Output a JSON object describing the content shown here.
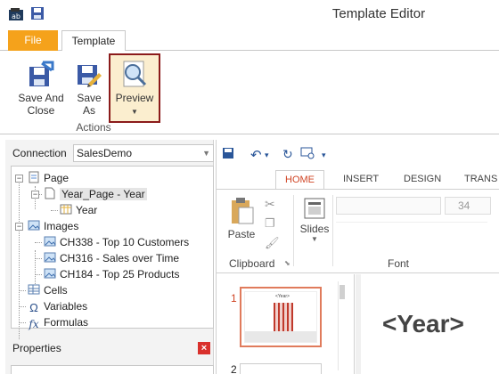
{
  "window": {
    "title": "Template Editor"
  },
  "tabs": {
    "file": "File",
    "template": "Template"
  },
  "ribbon": {
    "save_and_close_line1": "Save And",
    "save_and_close_line2": "Close",
    "save_as_line1": "Save",
    "save_as_line2": "As",
    "preview": "Preview",
    "group": "Actions"
  },
  "connection": {
    "label": "Connection",
    "value": "SalesDemo"
  },
  "tree": {
    "page": "Page",
    "year_page": "Year_Page - Year",
    "year": "Year",
    "images": "Images",
    "image1": "CH338 - Top 10 Customers",
    "image2": "CH316 - Sales over Time",
    "image3": "CH184 - Top 25 Products",
    "cells": "Cells",
    "variables": "Variables",
    "formulas": "Formulas"
  },
  "properties": {
    "title": "Properties"
  },
  "office": {
    "tabs": [
      "HOME",
      "INSERT",
      "DESIGN",
      "TRANS"
    ],
    "paste": "Paste",
    "slides": "Slides",
    "clipboard": "Clipboard",
    "font": "Font",
    "font_size": "34",
    "slide_numbers": [
      "1",
      "2"
    ],
    "slide_text": "<Year>",
    "thumb_text": "<Year>"
  },
  "colors": {
    "file_tab": "#f5a21b",
    "preview_border": "#8b1b1b",
    "preview_fill": "#fbeecf",
    "office_accent": "#d04525"
  }
}
